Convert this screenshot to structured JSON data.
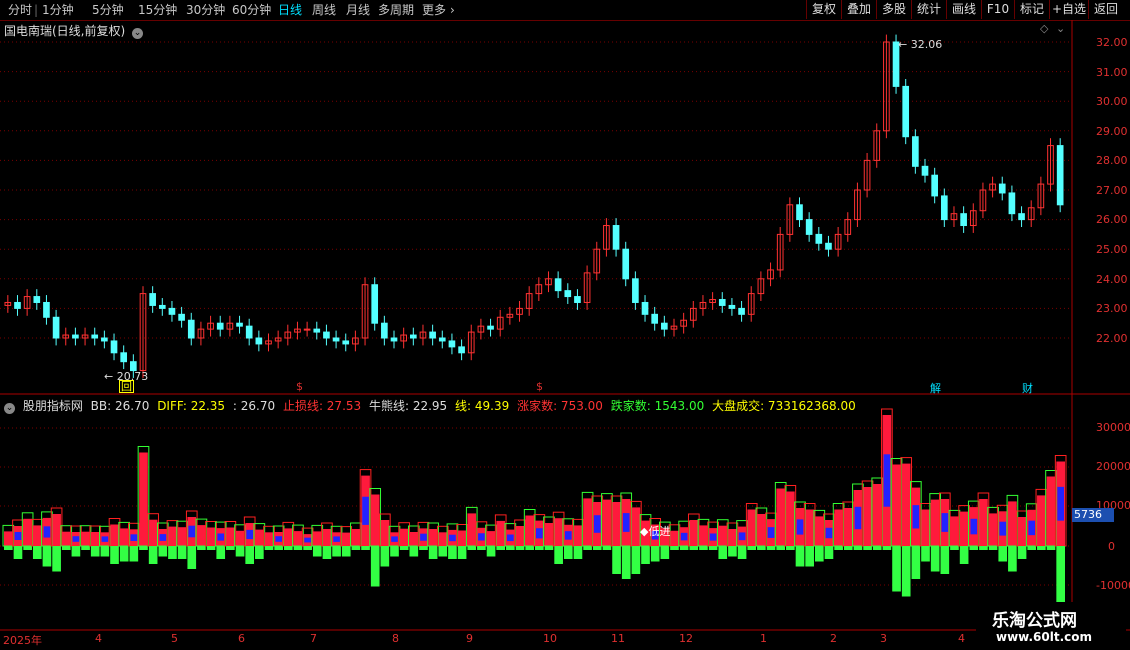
{
  "toolbar": {
    "periods": [
      "分时",
      "1分钟",
      "5分钟",
      "15分钟",
      "30分钟",
      "60分钟",
      "日线",
      "周线",
      "月线",
      "多周期",
      "更多"
    ],
    "active_period": "日线",
    "right_buttons": [
      "复权",
      "叠加",
      "多股",
      "统计",
      "画线",
      "F10",
      "标记",
      "+自选",
      "返回"
    ]
  },
  "main_chart": {
    "title": "国电南瑞(日线,前复权)",
    "high_label": "32.06",
    "low_label": "20.73",
    "price_ticks": [
      "32.00",
      "31.00",
      "30.00",
      "29.00",
      "28.00",
      "27.00",
      "26.00",
      "25.00",
      "24.00",
      "23.00",
      "22.00"
    ],
    "markers": [
      "回",
      "$",
      "$",
      "解",
      "财"
    ]
  },
  "indicator": {
    "name": "股朋指标网",
    "items": [
      {
        "label": "BB: 26.70",
        "color": "#dddddd"
      },
      {
        "label": "DIFF: 22.35",
        "color": "#ffff00"
      },
      {
        "label": ": 26.70",
        "color": "#dddddd"
      },
      {
        "label": "止损线: 27.53",
        "color": "#ff3333"
      },
      {
        "label": "牛熊线: 22.95",
        "color": "#dddddd"
      },
      {
        "label": "线: 49.39",
        "color": "#ffff00"
      },
      {
        "label": "涨家数: 753.00",
        "color": "#ff3333"
      },
      {
        "label": "跌家数: 1543.00",
        "color": "#33ff33"
      },
      {
        "label": "大盘成交: 733162368.00",
        "color": "#ffff00"
      }
    ],
    "axis_ticks": [
      "30000",
      "20000",
      "10000",
      "0",
      "-10000"
    ],
    "current_value": "5736",
    "annotation": "低进"
  },
  "time_axis": [
    "2025年",
    "4",
    "5",
    "6",
    "7",
    "8",
    "9",
    "10",
    "11",
    "12",
    "1",
    "2",
    "3",
    "4"
  ],
  "watermark": {
    "line1": "乐淘公式网",
    "line2": "www.60lt.com"
  },
  "chart_data": {
    "type": "candlestick",
    "series": [
      {
        "name": "price_close",
        "values": [
          23.2,
          23.0,
          23.4,
          23.2,
          22.7,
          22.0,
          22.1,
          22.0,
          22.1,
          22.0,
          21.9,
          21.5,
          21.2,
          20.9,
          23.5,
          23.1,
          23.0,
          22.8,
          22.6,
          22.0,
          22.3,
          22.5,
          22.3,
          22.5,
          22.4,
          22.0,
          21.8,
          21.9,
          22.0,
          22.2,
          22.3,
          22.3,
          22.2,
          22.0,
          21.9,
          21.8,
          22.0,
          23.8,
          22.5,
          22.0,
          21.9,
          22.1,
          22.0,
          22.2,
          22.0,
          21.9,
          21.7,
          21.5,
          22.2,
          22.4,
          22.3,
          22.7,
          22.8,
          23.0,
          23.5,
          23.8,
          24.0,
          23.6,
          23.4,
          23.2,
          24.2,
          25.0,
          25.8,
          25.0,
          24.0,
          23.2,
          22.8,
          22.5,
          22.3,
          22.4,
          22.6,
          23.0,
          23.2,
          23.3,
          23.1,
          23.0,
          22.8,
          23.5,
          24.0,
          24.3,
          25.5,
          26.5,
          26.0,
          25.5,
          25.2,
          25.0,
          25.5,
          26.0,
          27.0,
          28.0,
          29.0,
          32.0,
          30.5,
          28.8,
          27.8,
          27.5,
          26.8,
          26.0,
          26.2,
          25.8,
          26.3,
          27.0,
          27.2,
          26.9,
          26.2,
          26.0,
          26.4,
          27.2,
          28.5,
          26.5
        ]
      }
    ],
    "ylim": [
      21.0,
      32.5
    ]
  }
}
